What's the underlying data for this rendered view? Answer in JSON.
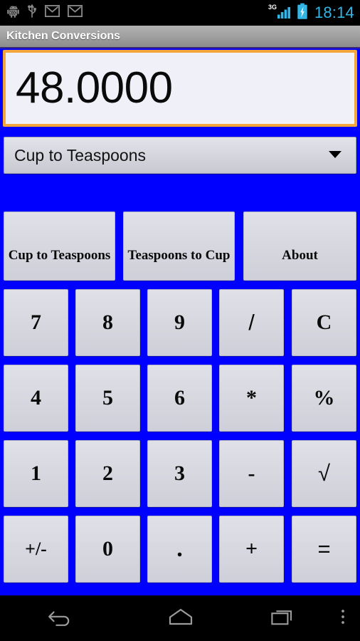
{
  "statusbar": {
    "icons": [
      "android-debug-icon",
      "usb-icon",
      "gmail-icon",
      "gmail-icon"
    ],
    "network_label": "3G",
    "signal_icon": "signal-bars-icon",
    "battery_icon": "battery-charging-icon",
    "time": "18:14",
    "accent_color": "#33B5E5"
  },
  "titlebar": {
    "title": "Kitchen Conversions"
  },
  "display": {
    "value": "48.0000",
    "border_color": "#F2A63C",
    "background_color": "#F0F0F8"
  },
  "spinner": {
    "selected": "Cup to Teaspoons",
    "caret_icon": "chevron-down-icon"
  },
  "actions": [
    {
      "label": "Cup to Teaspoons"
    },
    {
      "label": "Teaspoons to Cup"
    },
    {
      "label": "About"
    }
  ],
  "keypad": {
    "rows": [
      [
        {
          "label": "7",
          "style": "serif"
        },
        {
          "label": "8",
          "style": "serif"
        },
        {
          "label": "9",
          "style": "serif"
        },
        {
          "label": "/",
          "style": "sans"
        },
        {
          "label": "C",
          "style": "serif"
        }
      ],
      [
        {
          "label": "4",
          "style": "serif"
        },
        {
          "label": "5",
          "style": "serif"
        },
        {
          "label": "6",
          "style": "serif"
        },
        {
          "label": "*",
          "style": "serif"
        },
        {
          "label": "%",
          "style": "serif"
        }
      ],
      [
        {
          "label": "1",
          "style": "serif"
        },
        {
          "label": "2",
          "style": "serif"
        },
        {
          "label": "3",
          "style": "serif"
        },
        {
          "label": "-",
          "style": "serif"
        },
        {
          "label": "√",
          "style": "sans"
        }
      ],
      [
        {
          "label": "+/-",
          "style": "small"
        },
        {
          "label": "0",
          "style": "serif"
        },
        {
          "label": ".",
          "style": "dot"
        },
        {
          "label": "+",
          "style": "serif"
        },
        {
          "label": "=",
          "style": "sans"
        }
      ]
    ]
  },
  "navbar": {
    "back": "back-icon",
    "home": "home-icon",
    "recents": "recents-icon",
    "menu": "overflow-menu-icon"
  },
  "theme": {
    "background_color": "#0000FF",
    "button_face": "#D9D9E2"
  }
}
